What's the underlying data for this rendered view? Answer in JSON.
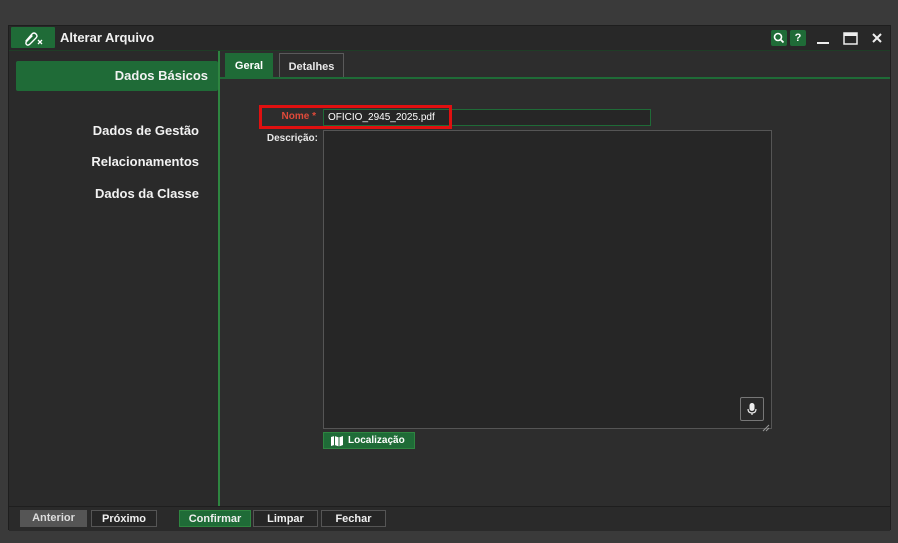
{
  "window": {
    "title": "Alterar Arquivo",
    "search_icon": "search-icon",
    "help_label": "?",
    "controls": [
      "minimize-icon",
      "maximize-icon",
      "close-icon"
    ]
  },
  "sidebar": {
    "items": [
      {
        "label": "Dados Básicos",
        "active": true
      },
      {
        "label": "Dados de Gestão",
        "active": false
      },
      {
        "label": "Relacionamentos",
        "active": false
      },
      {
        "label": "Dados da Classe",
        "active": false
      }
    ]
  },
  "tabs": [
    {
      "label": "Geral",
      "active": true
    },
    {
      "label": "Detalhes",
      "active": false
    }
  ],
  "form": {
    "nome_label": "Nome *",
    "nome_value": "OFÍCIO_2945_2025.pdf",
    "descricao_label": "Descrição:",
    "descricao_value": "",
    "localizacao_label": "Localização"
  },
  "footer": {
    "anterior": "Anterior",
    "proximo": "Próximo",
    "confirmar": "Confirmar",
    "limpar": "Limpar",
    "fechar": "Fechar"
  },
  "colors": {
    "accent": "#1f6b37",
    "required": "#e04a3a",
    "highlight": "#e01010",
    "background": "#2d2d2d"
  }
}
